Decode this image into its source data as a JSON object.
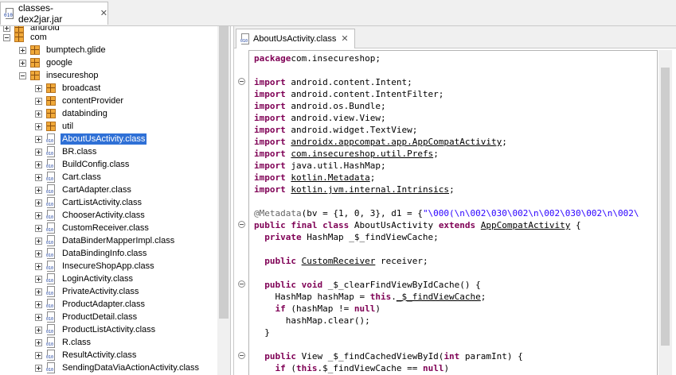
{
  "file_tab": {
    "label": "classes-dex2jar.jar"
  },
  "tree": {
    "cut_label": "android",
    "items": [
      {
        "label": "com",
        "kind": "package",
        "depth": 0,
        "toggle": "minus"
      },
      {
        "label": "bumptech.glide",
        "kind": "package",
        "depth": 1,
        "toggle": "plus"
      },
      {
        "label": "google",
        "kind": "package",
        "depth": 1,
        "toggle": "plus"
      },
      {
        "label": "insecureshop",
        "kind": "package",
        "depth": 1,
        "toggle": "minus"
      },
      {
        "label": "broadcast",
        "kind": "package",
        "depth": 2,
        "toggle": "plus"
      },
      {
        "label": "contentProvider",
        "kind": "package",
        "depth": 2,
        "toggle": "plus"
      },
      {
        "label": "databinding",
        "kind": "package",
        "depth": 2,
        "toggle": "plus"
      },
      {
        "label": "util",
        "kind": "package",
        "depth": 2,
        "toggle": "plus"
      },
      {
        "label": "AboutUsActivity.class",
        "kind": "class",
        "depth": 2,
        "toggle": "plus",
        "selected": true
      },
      {
        "label": "BR.class",
        "kind": "class",
        "depth": 2,
        "toggle": "plus"
      },
      {
        "label": "BuildConfig.class",
        "kind": "class",
        "depth": 2,
        "toggle": "plus"
      },
      {
        "label": "Cart.class",
        "kind": "class",
        "depth": 2,
        "toggle": "plus"
      },
      {
        "label": "CartAdapter.class",
        "kind": "class",
        "depth": 2,
        "toggle": "plus"
      },
      {
        "label": "CartListActivity.class",
        "kind": "class",
        "depth": 2,
        "toggle": "plus"
      },
      {
        "label": "ChooserActivity.class",
        "kind": "class",
        "depth": 2,
        "toggle": "plus"
      },
      {
        "label": "CustomReceiver.class",
        "kind": "class",
        "depth": 2,
        "toggle": "plus"
      },
      {
        "label": "DataBinderMapperImpl.class",
        "kind": "class",
        "depth": 2,
        "toggle": "plus"
      },
      {
        "label": "DataBindingInfo.class",
        "kind": "class",
        "depth": 2,
        "toggle": "plus"
      },
      {
        "label": "InsecureShopApp.class",
        "kind": "class",
        "depth": 2,
        "toggle": "plus"
      },
      {
        "label": "LoginActivity.class",
        "kind": "class",
        "depth": 2,
        "toggle": "plus"
      },
      {
        "label": "PrivateActivity.class",
        "kind": "class",
        "depth": 2,
        "toggle": "plus"
      },
      {
        "label": "ProductAdapter.class",
        "kind": "class",
        "depth": 2,
        "toggle": "plus"
      },
      {
        "label": "ProductDetail.class",
        "kind": "class",
        "depth": 2,
        "toggle": "plus"
      },
      {
        "label": "ProductListActivity.class",
        "kind": "class",
        "depth": 2,
        "toggle": "plus"
      },
      {
        "label": "R.class",
        "kind": "class",
        "depth": 2,
        "toggle": "plus"
      },
      {
        "label": "ResultActivity.class",
        "kind": "class",
        "depth": 2,
        "toggle": "plus"
      },
      {
        "label": "SendingDataViaActionActivity.class",
        "kind": "class",
        "depth": 2,
        "toggle": "plus"
      }
    ]
  },
  "editor_tab": {
    "label": "AboutUsActivity.class"
  },
  "code": [
    {
      "fold": false,
      "segs": [
        [
          "kw",
          "package"
        ],
        [
          "",
          "com.insecureshop;"
        ]
      ]
    },
    {
      "fold": false,
      "segs": []
    },
    {
      "fold": true,
      "segs": [
        [
          "kw",
          "import"
        ],
        [
          "",
          " android.content.Intent;"
        ]
      ]
    },
    {
      "fold": false,
      "segs": [
        [
          "kw",
          "import"
        ],
        [
          "",
          " android.content.IntentFilter;"
        ]
      ]
    },
    {
      "fold": false,
      "segs": [
        [
          "kw",
          "import"
        ],
        [
          "",
          " android.os.Bundle;"
        ]
      ]
    },
    {
      "fold": false,
      "segs": [
        [
          "kw",
          "import"
        ],
        [
          "",
          " android.view.View;"
        ]
      ]
    },
    {
      "fold": false,
      "segs": [
        [
          "kw",
          "import"
        ],
        [
          "",
          " android.widget.TextView;"
        ]
      ]
    },
    {
      "fold": false,
      "segs": [
        [
          "kw",
          "import"
        ],
        [
          "",
          " "
        ],
        [
          "ty",
          "androidx.appcompat.app.AppCompatActivity"
        ],
        [
          "",
          ";"
        ]
      ]
    },
    {
      "fold": false,
      "segs": [
        [
          "kw",
          "import"
        ],
        [
          "",
          " "
        ],
        [
          "ty",
          "com.insecureshop.util.Prefs"
        ],
        [
          "",
          ";"
        ]
      ]
    },
    {
      "fold": false,
      "segs": [
        [
          "kw",
          "import"
        ],
        [
          "",
          " java.util.HashMap;"
        ]
      ]
    },
    {
      "fold": false,
      "segs": [
        [
          "kw",
          "import"
        ],
        [
          "",
          " "
        ],
        [
          "ty",
          "kotlin.Metadata"
        ],
        [
          "",
          ";"
        ]
      ]
    },
    {
      "fold": false,
      "segs": [
        [
          "kw",
          "import"
        ],
        [
          "",
          " "
        ],
        [
          "ty",
          "kotlin.jvm.internal.Intrinsics"
        ],
        [
          "",
          ";"
        ]
      ]
    },
    {
      "fold": false,
      "segs": []
    },
    {
      "fold": false,
      "segs": [
        [
          "an",
          "@Metadata"
        ],
        [
          "",
          "(bv = {1, 0, 3}, d1 = {"
        ],
        [
          "st",
          "\"\\000(\\n\\002\\030\\002\\n\\002\\030\\002\\n\\002\\"
        ]
      ]
    },
    {
      "fold": true,
      "segs": [
        [
          "kw",
          "public final class"
        ],
        [
          "",
          " AboutUsActivity "
        ],
        [
          "kw",
          "extends"
        ],
        [
          "",
          " "
        ],
        [
          "ty",
          "AppCompatActivity"
        ],
        [
          "",
          " {"
        ]
      ]
    },
    {
      "fold": false,
      "segs": [
        [
          "",
          "  "
        ],
        [
          "kw",
          "private"
        ],
        [
          "",
          " HashMap _$_findViewCache;"
        ]
      ]
    },
    {
      "fold": false,
      "segs": []
    },
    {
      "fold": false,
      "segs": [
        [
          "",
          "  "
        ],
        [
          "kw",
          "public"
        ],
        [
          "",
          " "
        ],
        [
          "ty",
          "CustomReceiver"
        ],
        [
          "",
          " receiver;"
        ]
      ]
    },
    {
      "fold": false,
      "segs": []
    },
    {
      "fold": true,
      "segs": [
        [
          "",
          "  "
        ],
        [
          "kw",
          "public void"
        ],
        [
          "",
          " _$_clearFindViewByIdCache() {"
        ]
      ]
    },
    {
      "fold": false,
      "segs": [
        [
          "",
          "    HashMap hashMap = "
        ],
        [
          "kw",
          "this"
        ],
        [
          "",
          "."
        ],
        [
          "ty",
          "_$_findViewCache"
        ],
        [
          "",
          ";"
        ]
      ]
    },
    {
      "fold": false,
      "segs": [
        [
          "",
          "    "
        ],
        [
          "kw",
          "if"
        ],
        [
          "",
          " (hashMap != "
        ],
        [
          "kw",
          "null"
        ],
        [
          "",
          ")"
        ]
      ]
    },
    {
      "fold": false,
      "segs": [
        [
          "",
          "      hashMap.clear();"
        ]
      ]
    },
    {
      "fold": false,
      "segs": [
        [
          "",
          "  }"
        ]
      ]
    },
    {
      "fold": false,
      "segs": []
    },
    {
      "fold": true,
      "segs": [
        [
          "",
          "  "
        ],
        [
          "kw",
          "public"
        ],
        [
          "",
          " View _$_findCachedViewById("
        ],
        [
          "kw",
          "int"
        ],
        [
          "",
          " paramInt) {"
        ]
      ]
    },
    {
      "fold": false,
      "segs": [
        [
          "",
          "    "
        ],
        [
          "kw",
          "if"
        ],
        [
          "",
          " ("
        ],
        [
          "kw",
          "this"
        ],
        [
          "",
          ".$_findViewCache == "
        ],
        [
          "kw",
          "null"
        ],
        [
          "",
          ")"
        ]
      ]
    }
  ],
  "icons": {
    "file_tab": "jar-file-icon",
    "package": "package-icon",
    "class": "class-file-icon",
    "close": "close-icon"
  },
  "colors": {
    "keyword": "#7f0055",
    "selection": "#2f70d6",
    "string": "#2a00ff",
    "annotation": "#646464"
  }
}
